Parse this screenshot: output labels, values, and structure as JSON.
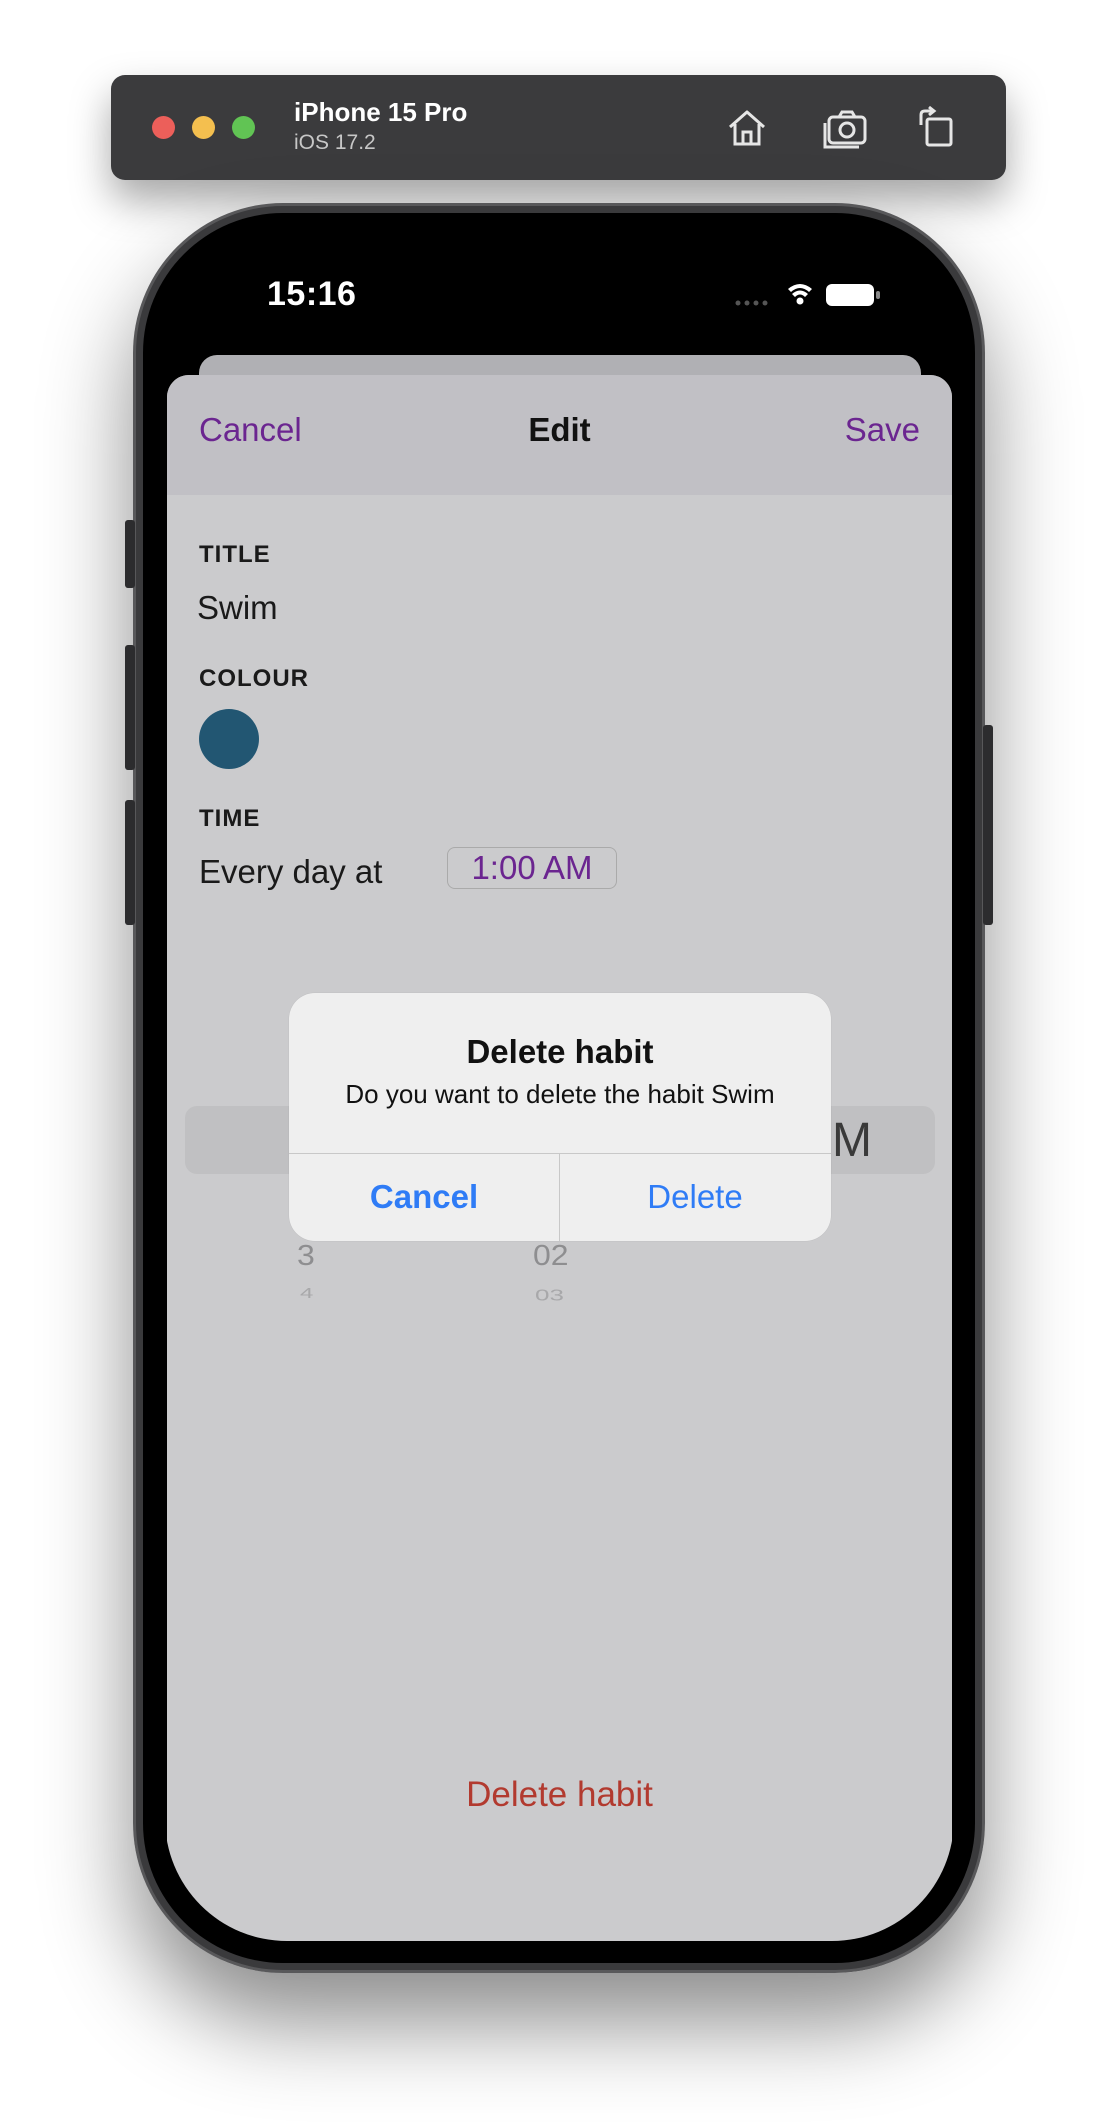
{
  "simulator": {
    "device_name": "iPhone 15 Pro",
    "os_version": "iOS 17.2",
    "toolbar_icons": [
      "home-icon",
      "screenshot-icon",
      "rotate-icon"
    ]
  },
  "status_bar": {
    "time": "15:16",
    "icons": [
      "cellular-icon",
      "wifi-icon",
      "battery-icon"
    ]
  },
  "nav": {
    "cancel_label": "Cancel",
    "title": "Edit",
    "save_label": "Save",
    "accent_color": "#6b2590"
  },
  "form": {
    "title_label": "TITLE",
    "title_value": "Swim",
    "colour_label": "COLOUR",
    "colour_value": "#225672",
    "time_label": "TIME",
    "time_prefix": "Every day at",
    "time_value": "1:00 AM"
  },
  "picker": {
    "hour_items": [
      "3",
      "4"
    ],
    "minute_items": [
      "02",
      "03"
    ],
    "ampm_fragment": "M"
  },
  "delete_habit_label": "Delete habit",
  "alert": {
    "title": "Delete habit",
    "message": "Do you want to delete the habit Swim",
    "cancel_label": "Cancel",
    "delete_label": "Delete",
    "button_color": "#2f7cf6"
  }
}
